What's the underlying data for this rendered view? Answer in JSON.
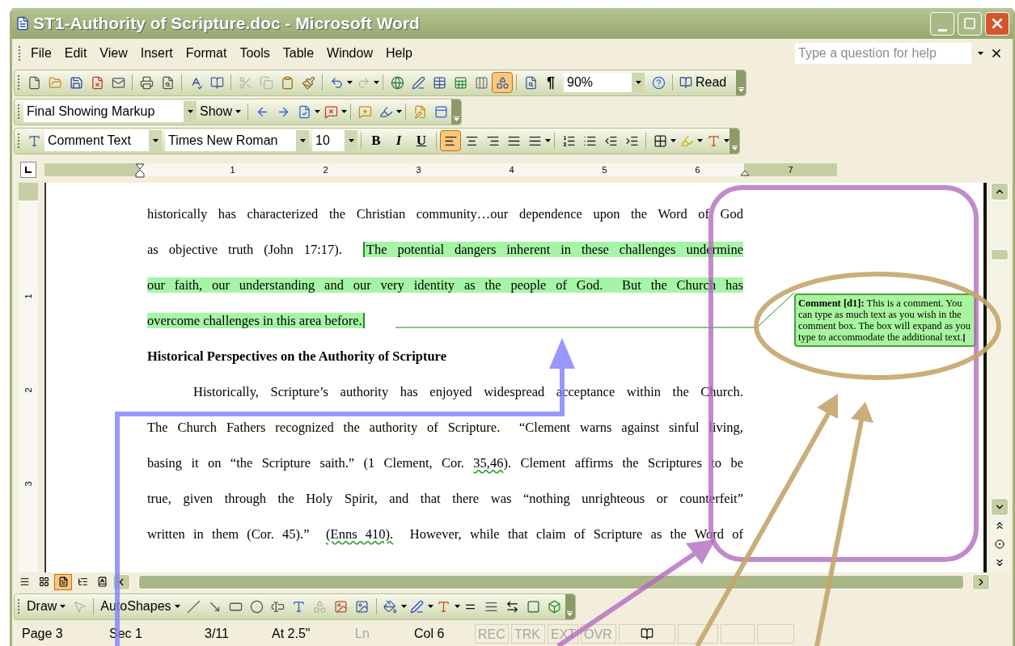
{
  "window": {
    "title": "ST1-Authority of Scripture.doc - Microsoft Word"
  },
  "menu": [
    "File",
    "Edit",
    "View",
    "Insert",
    "Format",
    "Tools",
    "Table",
    "Window",
    "Help"
  ],
  "help_box": {
    "placeholder": "Type a question for help"
  },
  "standard_toolbar": {
    "drawing_selected": true,
    "pilcrow": "¶",
    "zoom": "90%",
    "read": "Read"
  },
  "reviewing_toolbar": {
    "display": "Final Showing Markup",
    "show": "Show"
  },
  "formatting_toolbar": {
    "style": "Comment Text",
    "font": "Times New Roman",
    "size": "10",
    "text_buttons": [
      "B",
      "I",
      "U"
    ],
    "align": [
      {
        "selected": true
      },
      {
        "selected": false
      },
      {
        "selected": false
      },
      {
        "selected": false
      }
    ]
  },
  "ruler": {
    "marks": [
      "1",
      "2",
      "3",
      "4",
      "5",
      "6",
      "7"
    ]
  },
  "vertical_ruler": {
    "marks": [
      "1",
      "2",
      "3"
    ]
  },
  "document": {
    "lines": [
      {
        "kind": "para",
        "segments": [
          {
            "text": "historically has characterized the Christian community…our dependence upon the Word of God"
          }
        ]
      },
      {
        "kind": "para",
        "segments": [
          {
            "text": "as objective truth (John 17:17).  "
          },
          {
            "text": "The potential dangers inherent in these challenges undermine",
            "highlight": true,
            "starts_comment": true
          }
        ]
      },
      {
        "kind": "para",
        "segments": [
          {
            "text": "our faith, our understanding and our very identity as the people of God.  But the Church has",
            "highlight": true
          }
        ]
      },
      {
        "kind": "last",
        "segments": [
          {
            "text": "overcome challenges in this area before.",
            "highlight": true,
            "ends_comment": true
          }
        ]
      },
      {
        "kind": "heading",
        "segments": [
          {
            "text": "Historical Perspectives on the Authority of Scripture"
          }
        ]
      },
      {
        "kind": "indent",
        "segments": [
          {
            "text": "Historically, Scripture’s authority has enjoyed widespread acceptance within the Church."
          }
        ]
      },
      {
        "kind": "para",
        "segments": [
          {
            "text": "The Church Fathers recognized the authority of Scripture.  “Clement warns against sinful living,"
          }
        ]
      },
      {
        "kind": "para",
        "segments": [
          {
            "text": "basing it on “the Scripture saith.” (1 Clement, Cor. "
          },
          {
            "text": "35,46",
            "spelling": true
          },
          {
            "text": "). Clement affirms the Scriptures to be"
          }
        ]
      },
      {
        "kind": "para",
        "segments": [
          {
            "text": "true, given through the Holy Spirit, and that there was “nothing unrighteous or counterfeit”"
          }
        ]
      },
      {
        "kind": "para",
        "segments": [
          {
            "text": "written in them (Cor. 45).”  "
          },
          {
            "text": "(Enns 410).",
            "spelling": true
          },
          {
            "text": "  However, while that claim of Scripture as the Word of"
          }
        ]
      }
    ]
  },
  "comment": {
    "text": "**Comment [d1]:**  This is a comment. You can type as much text as you wish in the comment box. The box will expand as you type to accommodate the additional text."
  },
  "view_buttons": [
    {
      "selected": false
    },
    {
      "selected": false
    },
    {
      "selected": true
    },
    {
      "selected": false
    },
    {
      "selected": false
    }
  ],
  "drawing_toolbar": {
    "draw": "Draw",
    "autoshapes": "AutoShapes"
  },
  "status_bar": [
    {
      "text": "Page 3",
      "disabled": false
    },
    {
      "text": "Sec 1",
      "disabled": false
    },
    {
      "text": "3/11",
      "disabled": false
    },
    {
      "text": "At 2.5\"",
      "disabled": false
    },
    {
      "text": "Ln",
      "disabled": true
    },
    {
      "text": "Col 6",
      "disabled": false
    },
    {
      "text": "REC",
      "disabled": true
    },
    {
      "text": "TRK",
      "disabled": true
    },
    {
      "text": "EXT",
      "disabled": true
    },
    {
      "text": "OVR",
      "disabled": true
    }
  ]
}
